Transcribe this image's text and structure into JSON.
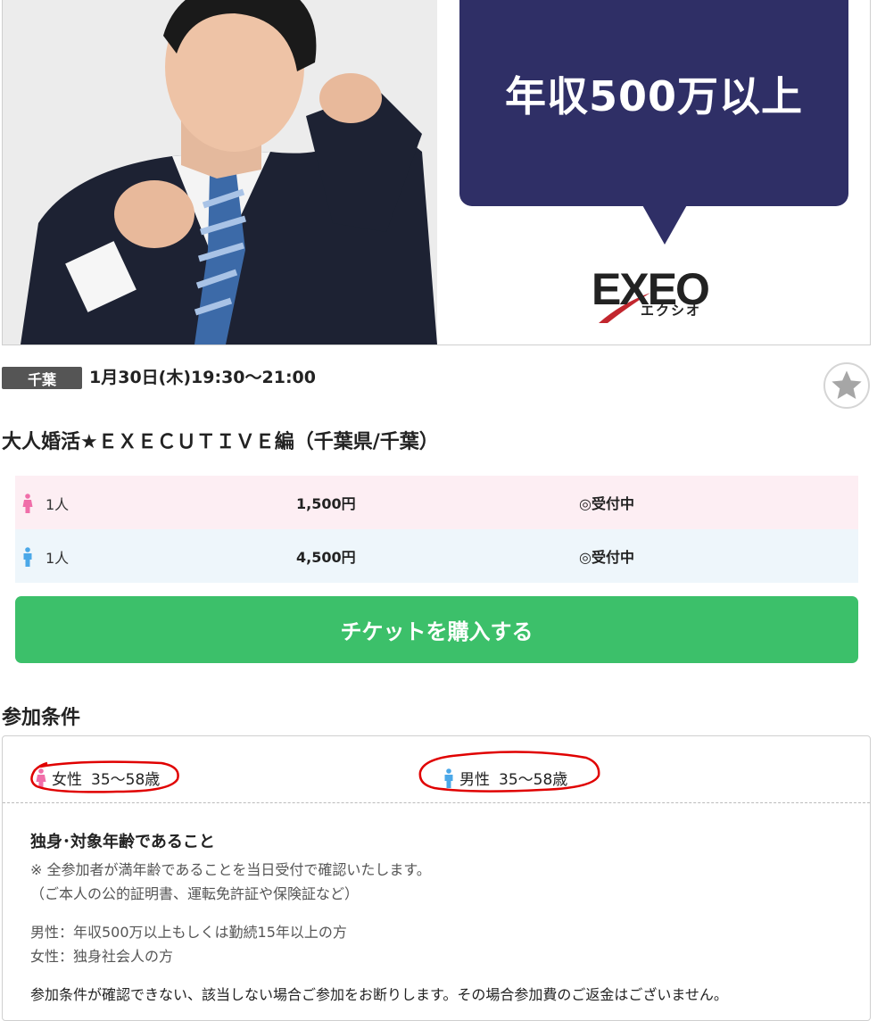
{
  "hero": {
    "bubble_text": "年収500万以上",
    "logo_main": "EXEO",
    "logo_sub": "エクシオ"
  },
  "event": {
    "area": "千葉",
    "datetime": "1月30日(木)19:30〜21:00",
    "title": "大人婚活★ＥＸＥＣＵＴＩＶＥ編（千葉県/千葉）"
  },
  "prices": [
    {
      "gender": "female",
      "count": "1人",
      "price": "1,500円",
      "status": "◎受付中"
    },
    {
      "gender": "male",
      "count": "1人",
      "price": "4,500円",
      "status": "◎受付中"
    }
  ],
  "buy_button": "チケットを購入する",
  "conditions": {
    "section_title": "参加条件",
    "female_label": "女性",
    "female_age": "35〜58歳",
    "male_label": "男性",
    "male_age": "35〜58歳",
    "heading": "独身･対象年齢であること",
    "notes": [
      "※ 全参加者が満年齢であることを当日受付で確認いたします。",
      "（ご本人の公的証明書、運転免許証や保険証など）"
    ],
    "requirements": [
      "男性：年収500万以上もしくは勤続15年以上の方",
      "女性：独身社会人の方"
    ],
    "refusal": "参加条件が確認できない、該当しない場合ご参加をお断りします。その場合参加費のご返金はございません。"
  },
  "colors": {
    "female": "#f06ea9",
    "male": "#4ba8e8",
    "buy": "#3cc06a",
    "bubble": "#2f2f66",
    "annotation": "#e00000"
  }
}
